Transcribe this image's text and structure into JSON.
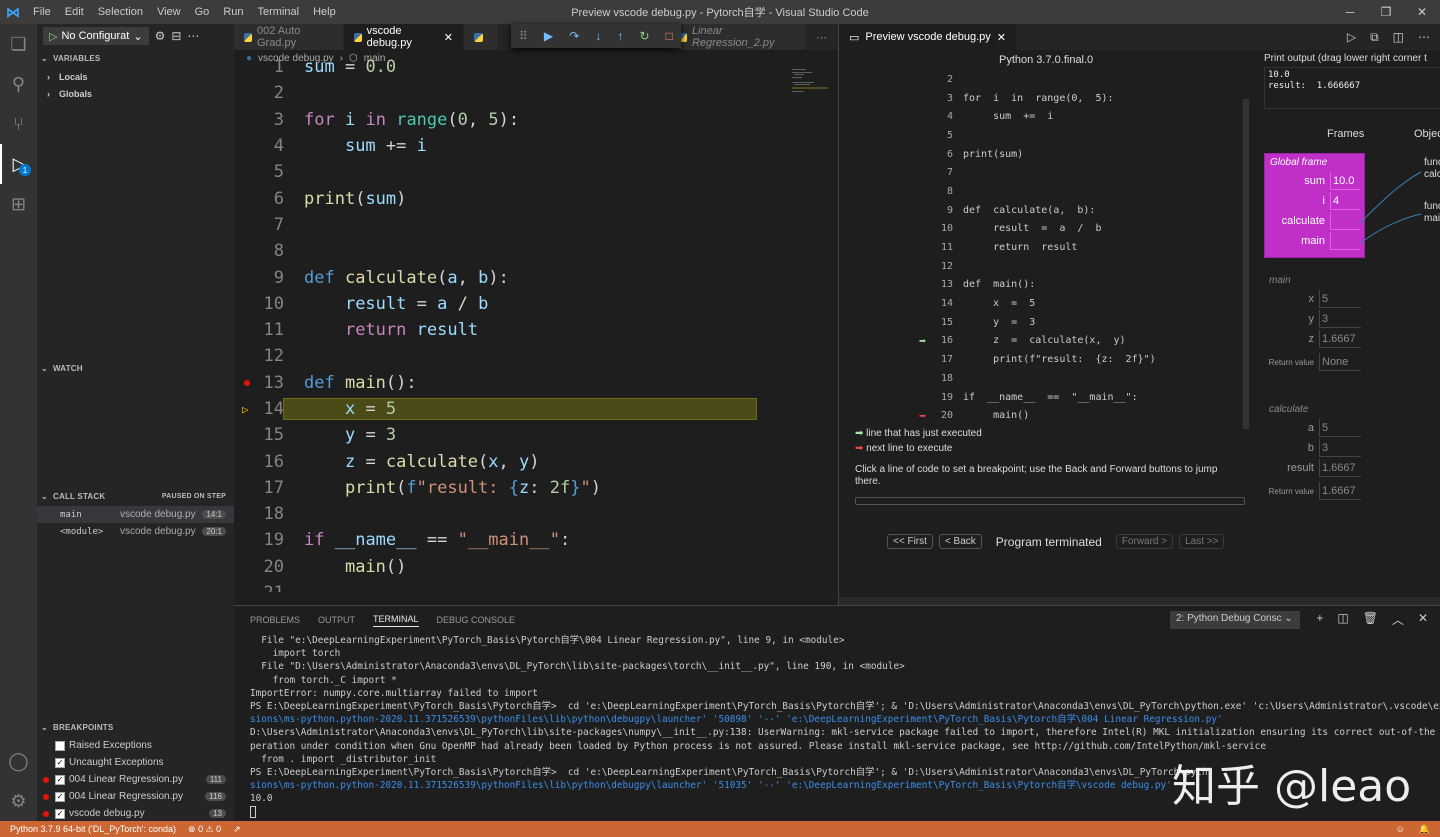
{
  "window": {
    "title": "Preview vscode debug.py - Pytorch自学 - Visual Studio Code",
    "menu": [
      "File",
      "Edit",
      "Selection",
      "View",
      "Go",
      "Run",
      "Terminal",
      "Help"
    ]
  },
  "sidebar": {
    "run_config": "No Configurat",
    "variables_header": "VARIABLES",
    "locals": "Locals",
    "globals": "Globals",
    "watch_header": "WATCH",
    "callstack_header": "CALL STACK",
    "callstack_status": "PAUSED ON STEP",
    "callstack": [
      {
        "fn": "main",
        "file": "vscode debug.py",
        "ln": "14:1"
      },
      {
        "fn": "<module>",
        "file": "vscode debug.py",
        "ln": "20:1"
      }
    ],
    "breakpoints_header": "BREAKPOINTS",
    "breakpoints": [
      {
        "label": "Raised Exceptions",
        "checked": false,
        "dot": false,
        "ln": ""
      },
      {
        "label": "Uncaught Exceptions",
        "checked": true,
        "dot": false,
        "ln": ""
      },
      {
        "label": "004 Linear Regression.py",
        "checked": true,
        "dot": true,
        "ln": "111"
      },
      {
        "label": "004 Linear Regression.py",
        "checked": true,
        "dot": true,
        "ln": "116"
      },
      {
        "label": "vscode debug.py",
        "checked": true,
        "dot": true,
        "ln": "13"
      }
    ],
    "debug_badge": "1"
  },
  "editor": {
    "tabs": [
      {
        "label": "002 Auto Grad.py",
        "active": false
      },
      {
        "label": "vscode debug.py",
        "active": true
      },
      {
        "label": "",
        "active": false
      },
      {
        "label": "Linear Regression_2.py",
        "active": false
      }
    ],
    "breadcrumb_file": "vscode debug.py",
    "breadcrumb_symbol": "main",
    "lines": [
      {
        "n": "1",
        "html": "<span class=\"var\">sum</span> = <span class=\"num\">0.0</span>"
      },
      {
        "n": "2",
        "html": ""
      },
      {
        "n": "3",
        "html": "<span class=\"kw2\">for</span> <span class=\"var\">i</span> <span class=\"kw2\">in</span> <span class=\"bi\">range</span>(<span class=\"num\">0</span>, <span class=\"num\">5</span>):"
      },
      {
        "n": "4",
        "html": "    <span class=\"var\">sum</span> += <span class=\"var\">i</span>"
      },
      {
        "n": "5",
        "html": ""
      },
      {
        "n": "6",
        "html": "<span class=\"fnc\">print</span>(<span class=\"var\">sum</span>)"
      },
      {
        "n": "7",
        "html": ""
      },
      {
        "n": "8",
        "html": ""
      },
      {
        "n": "9",
        "html": "<span class=\"kw\">def</span> <span class=\"fnc\">calculate</span>(<span class=\"var\">a</span>, <span class=\"var\">b</span>):"
      },
      {
        "n": "10",
        "html": "    <span class=\"var\">result</span> = <span class=\"var\">a</span> / <span class=\"var\">b</span>"
      },
      {
        "n": "11",
        "html": "    <span class=\"kw2\">return</span> <span class=\"var\">result</span>"
      },
      {
        "n": "12",
        "html": ""
      },
      {
        "n": "13",
        "html": "<span class=\"kw\">def</span> <span class=\"fnc\">main</span>():",
        "bp": true
      },
      {
        "n": "14",
        "html": "    <span class=\"var\">x</span> = <span class=\"num\">5</span>",
        "hl": true
      },
      {
        "n": "15",
        "html": "    <span class=\"var\">y</span> = <span class=\"num\">3</span>"
      },
      {
        "n": "16",
        "html": "    <span class=\"var\">z</span> = <span class=\"fnc\">calculate</span>(<span class=\"var\">x</span>, <span class=\"var\">y</span>)"
      },
      {
        "n": "17",
        "html": "    <span class=\"fnc\">print</span>(<span class=\"kw\">f</span><span class=\"str\">\"result: </span><span class=\"kw\">{</span><span class=\"var\">z</span>: <span class=\"num\">2f</span><span class=\"kw\">}</span><span class=\"str\">\"</span>)"
      },
      {
        "n": "18",
        "html": ""
      },
      {
        "n": "19",
        "html": "<span class=\"kw2\">if</span> <span class=\"var\">__name__</span> == <span class=\"str\">\"__main__\"</span>:"
      },
      {
        "n": "20",
        "html": "    <span class=\"fnc\">main</span>()"
      },
      {
        "n": "21",
        "html": ""
      }
    ]
  },
  "preview": {
    "tab_label": "Preview vscode debug.py",
    "python_version": "Python 3.7.0.final.0",
    "lines": [
      {
        "n": "2",
        "c": ""
      },
      {
        "n": "3",
        "c": "for  i  in  range(0,  5):"
      },
      {
        "n": "4",
        "c": "     sum  +=  i"
      },
      {
        "n": "5",
        "c": ""
      },
      {
        "n": "6",
        "c": "print(sum)"
      },
      {
        "n": "7",
        "c": ""
      },
      {
        "n": "8",
        "c": ""
      },
      {
        "n": "9",
        "c": "def  calculate(a,  b):"
      },
      {
        "n": "10",
        "c": "     result  =  a  /  b"
      },
      {
        "n": "11",
        "c": "     return  result"
      },
      {
        "n": "12",
        "c": ""
      },
      {
        "n": "13",
        "c": "def  main():"
      },
      {
        "n": "14",
        "c": "     x  =  5"
      },
      {
        "n": "15",
        "c": "     y  =  3"
      },
      {
        "n": "16",
        "c": "     z  =  calculate(x,  y)",
        "arrow": "green"
      },
      {
        "n": "17",
        "c": "     print(f\"result:  {z:  2f}\")"
      },
      {
        "n": "18",
        "c": ""
      },
      {
        "n": "19",
        "c": "if  __name__  ==  \"__main__\":"
      },
      {
        "n": "20",
        "c": "     main()",
        "arrow": "red"
      }
    ],
    "legend_green": "line that has just executed",
    "legend_red": "next line to execute",
    "note": "Click a line of code to set a breakpoint; use the Back and Forward buttons to jump there.",
    "nav_first": "<< First",
    "nav_back": "< Back",
    "nav_status": "Program terminated",
    "nav_forward": "Forward >",
    "nav_last": "Last >>",
    "output_label": "Print output (drag lower right corner t",
    "output_text": "10.0\nresult:  1.666667",
    "frames_header": "Frames",
    "objects_header": "Objec",
    "global_frame_name": "Global frame",
    "global_frame": [
      {
        "k": "sum",
        "v": "10.0"
      },
      {
        "k": "i",
        "v": "4"
      },
      {
        "k": "calculate",
        "v": ""
      },
      {
        "k": "main",
        "v": ""
      }
    ],
    "main_frame_name": "main",
    "main_frame": [
      {
        "k": "x",
        "v": "5"
      },
      {
        "k": "y",
        "v": "3"
      },
      {
        "k": "z",
        "v": "1.6667"
      },
      {
        "k": "Return value",
        "v": "None"
      }
    ],
    "calc_frame_name": "calculate",
    "calc_frame": [
      {
        "k": "a",
        "v": "5"
      },
      {
        "k": "b",
        "v": "3"
      },
      {
        "k": "result",
        "v": "1.6667"
      },
      {
        "k": "Return value",
        "v": "1.6667"
      }
    ],
    "obj1": "func\ncalc",
    "obj2": "func\nmai"
  },
  "panel": {
    "tabs": [
      "PROBLEMS",
      "OUTPUT",
      "TERMINAL",
      "DEBUG CONSOLE"
    ],
    "active_tab": "TERMINAL",
    "terminal_select": "2: Python Debug Consc",
    "terminal_lines": [
      "  File \"e:\\DeepLearningExperiment\\PyTorch_Basis\\Pytorch自学\\004 Linear Regression.py\", line 9, in <module>",
      "    import torch",
      "  File \"D:\\Users\\Administrator\\Anaconda3\\envs\\DL_PyTorch\\lib\\site-packages\\torch\\__init__.py\", line 190, in <module>",
      "    from torch._C import *",
      "ImportError: numpy.core.multiarray failed to import",
      "PS E:\\DeepLearningExperiment\\PyTorch_Basis\\Pytorch自学>  cd 'e:\\DeepLearningExperiment\\PyTorch_Basis\\Pytorch自学'; & 'D:\\Users\\Administrator\\Anaconda3\\envs\\DL_PyTorch\\python.exe' 'c:\\Users\\Administrator\\.vscode\\exten",
      "sions\\ms-python.python-2020.11.371526539\\pythonFiles\\lib\\python\\debugpy\\launcher' '50898' '--' 'e:\\DeepLearningExperiment\\PyTorch_Basis\\Pytorch自学\\004 Linear Regression.py'",
      "D:\\Users\\Administrator\\Anaconda3\\envs\\DL_PyTorch\\lib\\site-packages\\numpy\\__init__.py:138: UserWarning: mkl-service package failed to import, therefore Intel(R) MKL initialization ensuring its correct out-of-the box o",
      "peration under condition when Gnu OpenMP had already been loaded by Python process is not assured. Please install mkl-service package, see http://github.com/IntelPython/mkl-service",
      "  from . import _distributor_init",
      "PS E:\\DeepLearningExperiment\\PyTorch_Basis\\Pytorch自学>  cd 'e:\\DeepLearningExperiment\\PyTorch_Basis\\Pytorch自学'; & 'D:\\Users\\Administrator\\Anaconda3\\envs\\DL_PyTorch\\pyth",
      "sions\\ms-python.python-2020.11.371526539\\pythonFiles\\lib\\python\\debugpy\\launcher' '51035' '--' 'e:\\DeepLearningExperiment\\PyTorch_Basis\\Pytorch自学\\vscode debug.py'",
      "10.0"
    ],
    "watermark": "知乎 @leao"
  },
  "statusbar": {
    "interpreter": "Python 3.7.9 64-bit ('DL_PyTorch': conda)",
    "problems": "⊗ 0 ⚠ 0"
  },
  "colors": {
    "statusbar": "#cc6633",
    "frame_highlight": "#c030c8",
    "current_line": "#4b4b18"
  }
}
